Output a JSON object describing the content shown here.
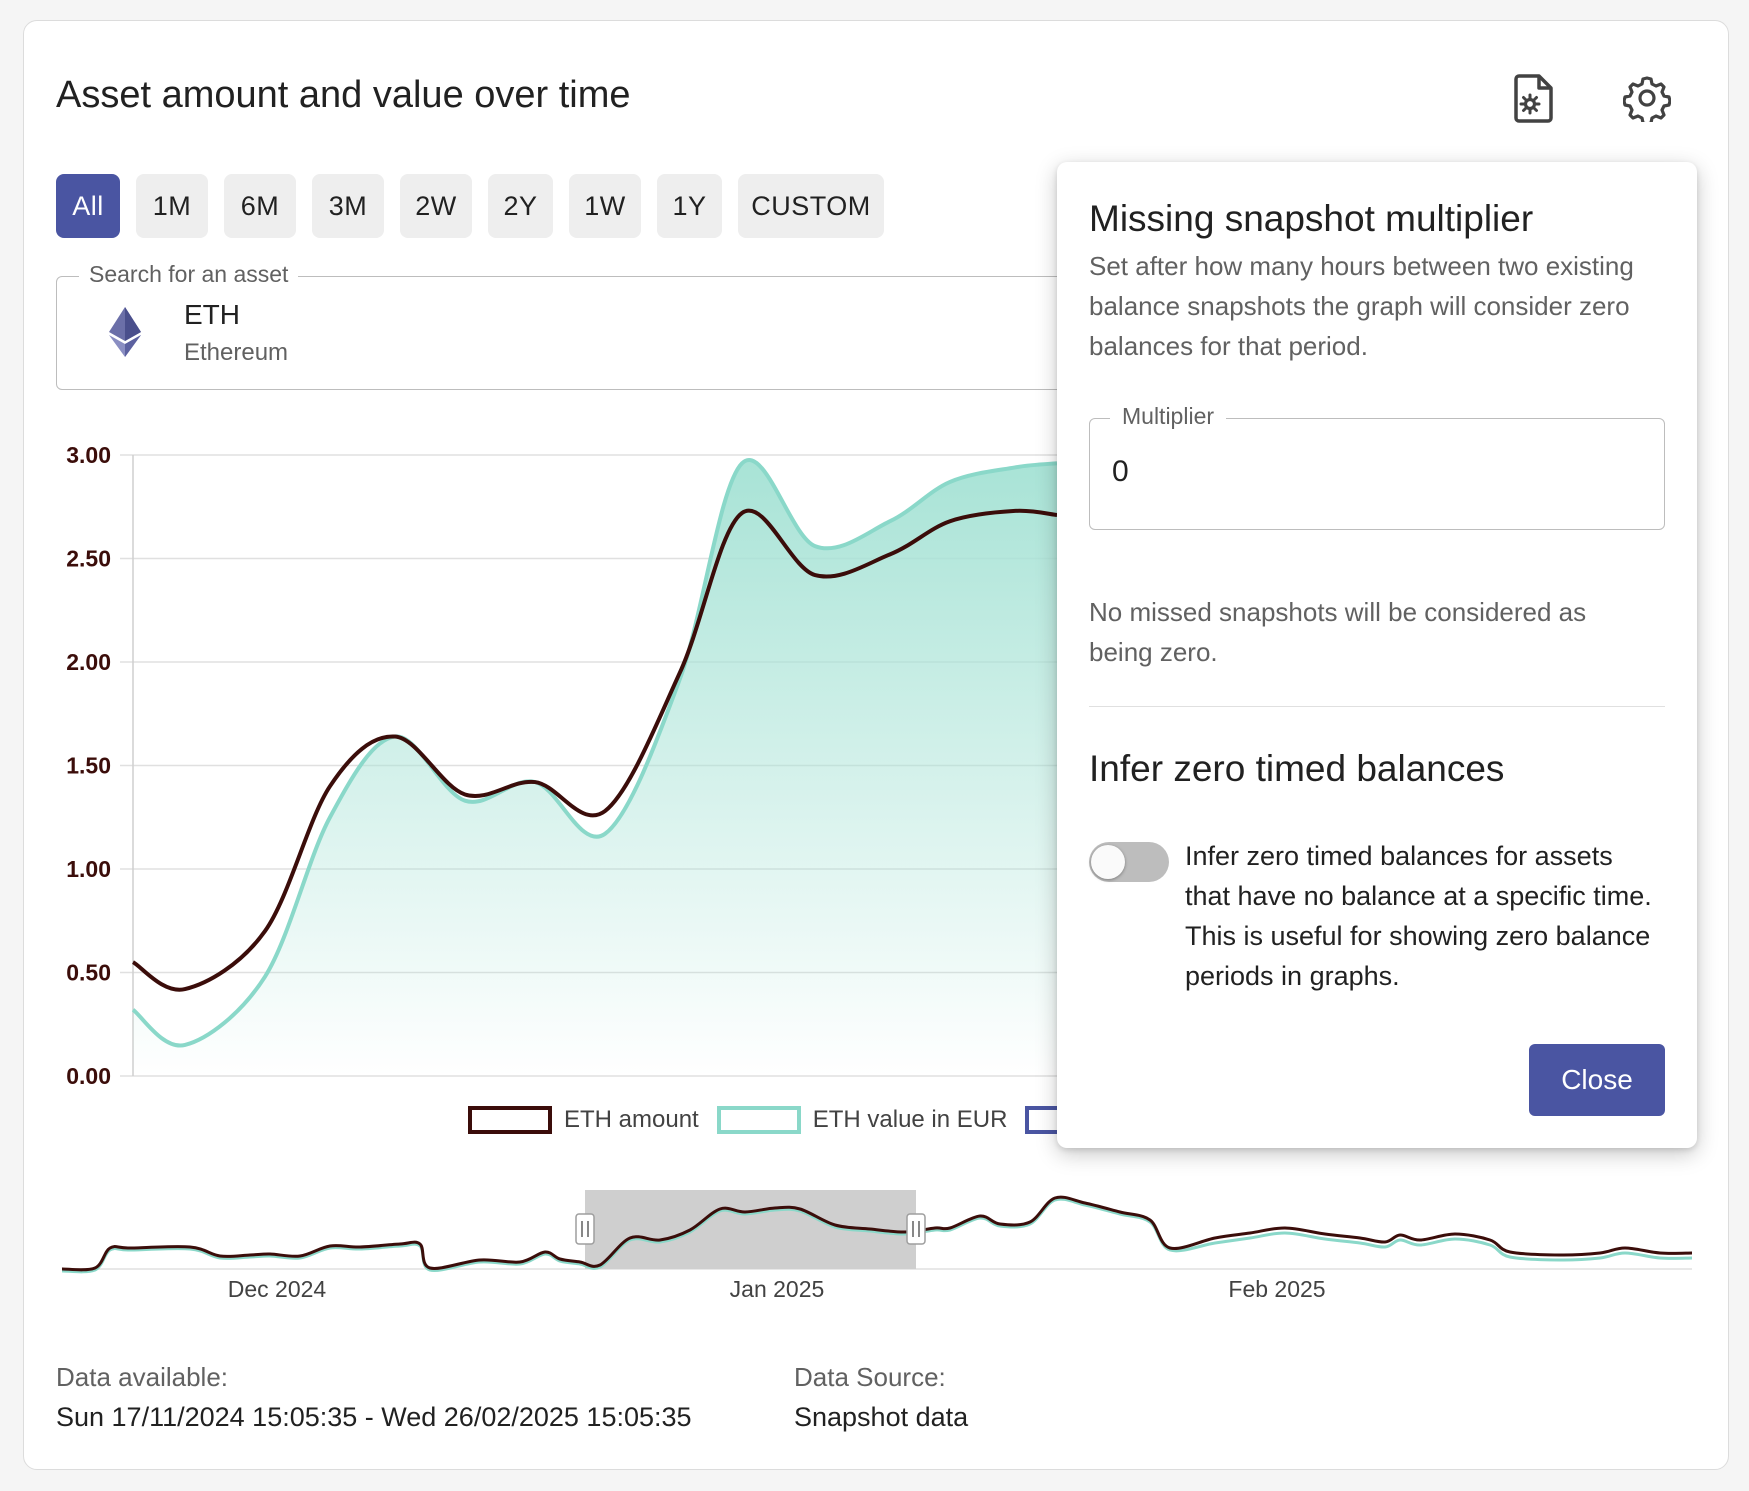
{
  "header": {
    "title": "Asset amount and value over time"
  },
  "ranges": [
    "All",
    "1M",
    "6M",
    "3M",
    "2W",
    "2Y",
    "1W",
    "1Y",
    "CUSTOM"
  ],
  "active_range": "All",
  "search": {
    "label": "Search for an asset",
    "symbol": "ETH",
    "name": "Ethereum"
  },
  "legend": [
    "ETH amount",
    "ETH value in EUR"
  ],
  "colors": {
    "amount": "#3b0d0a",
    "value": "#8ad8c9",
    "fill": "#a8e3d6",
    "accent": "#4a55a2"
  },
  "chart_data": {
    "type": "line",
    "y_ticks": [
      "3.00",
      "2.50",
      "2.00",
      "1.50",
      "1.00",
      "0.50",
      "0.00"
    ],
    "ylim": [
      0,
      3
    ],
    "series": [
      {
        "name": "ETH amount",
        "values": [
          0.55,
          0.42,
          0.7,
          1.4,
          1.64,
          1.36,
          1.42,
          1.28,
          1.95,
          2.72,
          2.42,
          2.52,
          2.68,
          2.73,
          2.71
        ]
      },
      {
        "name": "ETH value in EUR",
        "values": [
          0.32,
          0.15,
          0.48,
          1.25,
          1.64,
          1.33,
          1.42,
          1.17,
          1.92,
          2.96,
          2.56,
          2.68,
          2.87,
          2.94,
          2.96
        ]
      }
    ],
    "navigator_ticks": [
      "Dec 2024",
      "Jan 2025",
      "Feb 2025"
    ]
  },
  "footer": {
    "available_label": "Data available:",
    "available_value": "Sun 17/11/2024 15:05:35 - Wed 26/02/2025 15:05:35",
    "source_label": "Data Source:",
    "source_value": "Snapshot data"
  },
  "panel": {
    "title": "Missing snapshot multiplier",
    "description": "Set after how many hours between two existing balance snapshots the graph will consider zero balances for that period.",
    "multiplier_label": "Multiplier",
    "multiplier_value": "0",
    "hint": "No missed snapshots will be considered as being zero.",
    "infer_title": "Infer zero timed balances",
    "infer_description": "Infer zero timed balances for assets that have no balance at a specific time. This is useful for showing zero balance periods in graphs.",
    "infer_enabled": false,
    "close_label": "Close"
  }
}
